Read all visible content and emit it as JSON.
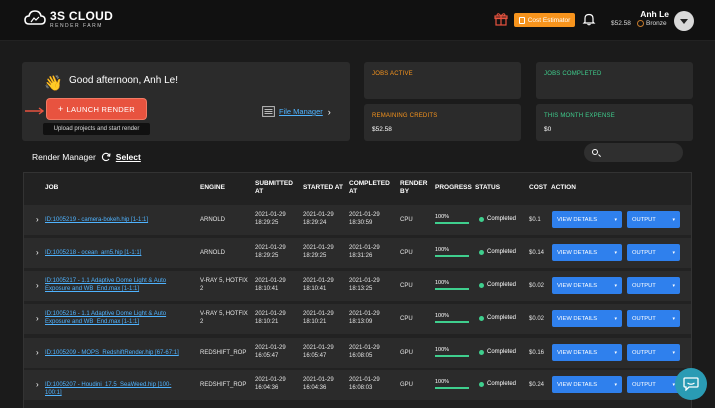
{
  "brand": {
    "title": "3S CLOUD",
    "subtitle": "RENDER FARM"
  },
  "header": {
    "cost_estimator": "Cost Estimator",
    "user_name": "Anh Le",
    "credit": "$52.58",
    "tier": "Bronze"
  },
  "greeting": {
    "text": "Good afternoon, Anh Le!",
    "launch_label": "LAUNCH RENDER",
    "launch_tooltip": "Upload projects and start render",
    "file_manager": "File Manager"
  },
  "stats": {
    "jobs_active": {
      "label": "JOBS ACTIVE",
      "value": ""
    },
    "jobs_completed": {
      "label": "JOBS COMPLETED",
      "value": ""
    },
    "remaining_credits": {
      "label": "REMAINING CREDITS",
      "value": "$52.58"
    },
    "month_expense": {
      "label": "THIS MONTH EXPENSE",
      "value": "$0"
    }
  },
  "render_manager": {
    "title": "Render Manager",
    "select": "Select",
    "search_placeholder": ""
  },
  "table": {
    "headers": {
      "job": "JOB",
      "engine": "ENGINE",
      "submitted": "SUBMITTED AT",
      "started": "STARTED AT",
      "completed": "COMPLETED AT",
      "render_by": "RENDER BY",
      "progress": "PROGRESS",
      "status": "STATUS",
      "cost": "COST",
      "action": "ACTION"
    },
    "view_label": "VIEW DETAILS",
    "output_label": "OUTPUT",
    "rows": [
      {
        "job": "ID:1005219 - camera-bokeh.hip [1-1:1]",
        "engine": "ARNOLD",
        "submitted_date": "2021-01-29",
        "submitted_time": "18:29:25",
        "started_date": "2021-01-29",
        "started_time": "18:29:24",
        "completed_date": "2021-01-29",
        "completed_time": "18:30:59",
        "render_by": "CPU",
        "progress": "100%",
        "progress_value": 1.0,
        "status": "Completed",
        "cost": "$0.1"
      },
      {
        "job": "ID:1005218 - ocean_arn5.hip [1-1:1]",
        "engine": "ARNOLD",
        "submitted_date": "2021-01-29",
        "submitted_time": "18:29:25",
        "started_date": "2021-01-29",
        "started_time": "18:29:25",
        "completed_date": "2021-01-29",
        "completed_time": "18:31:26",
        "render_by": "CPU",
        "progress": "100%",
        "progress_value": 1.0,
        "status": "Completed",
        "cost": "$0.14"
      },
      {
        "job": "ID:1005217 - 1.1 Adaptive Dome Light & Auto Exposure and WB_End.max [1-1:1]",
        "engine": "V-RAY 5, HOTFIX 2",
        "submitted_date": "2021-01-29",
        "submitted_time": "18:10:41",
        "started_date": "2021-01-29",
        "started_time": "18:10:41",
        "completed_date": "2021-01-29",
        "completed_time": "18:13:25",
        "render_by": "CPU",
        "progress": "100%",
        "progress_value": 1.0,
        "status": "Completed",
        "cost": "$0.02"
      },
      {
        "job": "ID:1005216 - 1.1 Adaptive Dome Light & Auto Exposure and WB_End.max [1-1:1]",
        "engine": "V-RAY 5, HOTFIX 2",
        "submitted_date": "2021-01-29",
        "submitted_time": "18:10:21",
        "started_date": "2021-01-29",
        "started_time": "18:10:21",
        "completed_date": "2021-01-29",
        "completed_time": "18:13:09",
        "render_by": "CPU",
        "progress": "100%",
        "progress_value": 1.0,
        "status": "Completed",
        "cost": "$0.02"
      },
      {
        "job": "ID:1005209 - MOPS_RedshiftRender.hip [67-67:1]",
        "engine": "REDSHIFT_ROP",
        "submitted_date": "2021-01-29",
        "submitted_time": "16:05:47",
        "started_date": "2021-01-29",
        "started_time": "16:05:47",
        "completed_date": "2021-01-29",
        "completed_time": "16:08:05",
        "render_by": "GPU",
        "progress": "100%",
        "progress_value": 1.0,
        "status": "Completed",
        "cost": "$0.16"
      },
      {
        "job": "ID:1005207 - Houdini_17.5_SeaWeed.hip [100-100:1]",
        "engine": "REDSHIFT_ROP",
        "submitted_date": "2021-01-29",
        "submitted_time": "16:04:36",
        "started_date": "2021-01-29",
        "started_time": "16:04:36",
        "completed_date": "2021-01-29",
        "completed_time": "16:08:03",
        "render_by": "GPU",
        "progress": "100%",
        "progress_value": 1.0,
        "status": "Completed",
        "cost": "$0.24"
      }
    ]
  },
  "colors": {
    "accent": "#e8533f",
    "link": "#4fb3ff",
    "button": "#2f80ed",
    "success": "#3fcf8e",
    "warning": "#f7941d"
  },
  "icons": [
    "cloud-logo-icon",
    "gift-icon",
    "calculator-icon",
    "bell-icon",
    "medal-icon",
    "chevron-down-icon",
    "wave-hand-icon",
    "arrow-right-icon",
    "plus-icon",
    "file-manager-icon",
    "refresh-icon",
    "search-icon",
    "chat-icon"
  ]
}
